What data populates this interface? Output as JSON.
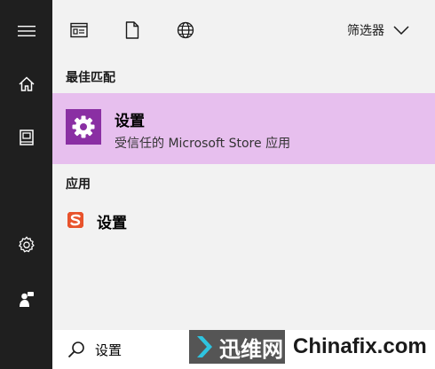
{
  "toolbar": {
    "filter_label": "筛选器"
  },
  "sections": {
    "best_match_label": "最佳匹配",
    "apps_label": "应用"
  },
  "best_match": {
    "title": "设置",
    "subtitle": "受信任的 Microsoft Store 应用",
    "icon": "gear-icon",
    "icon_bg": "#8a2fa3",
    "highlight_color": "#e7bfee"
  },
  "apps": [
    {
      "label": "设置",
      "icon": "sogou-icon",
      "icon_color": "#e8532c"
    }
  ],
  "search": {
    "value": "设置"
  },
  "watermark": {
    "badge_text": "迅维网",
    "site_text": "Chinafix.com"
  }
}
